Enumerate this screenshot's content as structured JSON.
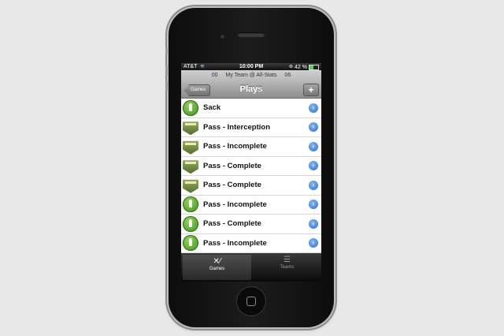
{
  "status_bar": {
    "carrier": "AT&T",
    "time": "10:00 PM",
    "battery": "42 %",
    "battery_level": 0.42
  },
  "scoreboard": {
    "home_score": "00",
    "matchup": "My Team @ All-Stats",
    "away_score": "06"
  },
  "nav": {
    "back_label": "Games",
    "title": "Plays",
    "add_label": "+"
  },
  "plays": [
    {
      "label": "Sack",
      "icon": "ball-icon"
    },
    {
      "label": "Pass - Interception",
      "icon": "away-badge-icon"
    },
    {
      "label": "Pass - Incomplete",
      "icon": "away-badge-icon"
    },
    {
      "label": "Pass - Complete",
      "icon": "away-badge-icon"
    },
    {
      "label": "Pass - Complete",
      "icon": "away-badge-icon"
    },
    {
      "label": "Pass - Incomplete",
      "icon": "ball-icon"
    },
    {
      "label": "Pass - Complete",
      "icon": "ball-icon"
    },
    {
      "label": "Pass - Incomplete",
      "icon": "ball-icon"
    }
  ],
  "tabs": [
    {
      "label": "Games",
      "icon": "games-icon",
      "active": true
    },
    {
      "label": "Teams",
      "icon": "teams-icon",
      "active": false
    }
  ],
  "colors": {
    "accent_blue": "#2f6fd0",
    "ball_green": "#3f8f1c",
    "battery_green": "#4cd94c"
  }
}
